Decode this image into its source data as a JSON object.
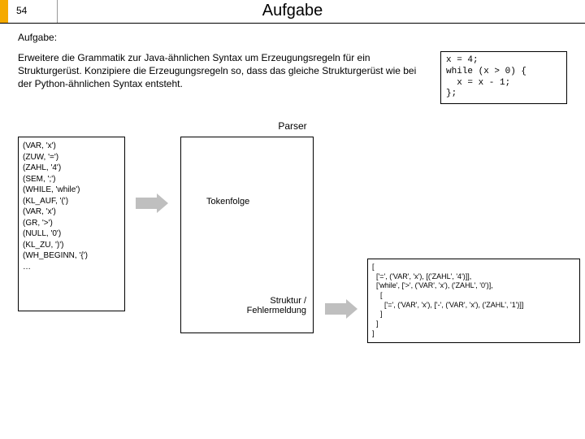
{
  "header": {
    "page_number": "54",
    "title": "Aufgabe"
  },
  "subhead": "Aufgabe:",
  "description": "Erweitere die Grammatik zur Java-ähnlichen Syntax um Erzeugungsregeln für ein Strukturgerüst. Konzipiere die Erzeugungsregeln so, dass das gleiche Strukturgerüst wie bei der Python-ähnlichen Syntax entsteht.",
  "source_code": "x = 4;\nwhile (x > 0) {\n  x = x - 1;\n};",
  "parser": {
    "label": "Parser",
    "input_label": "Tokenfolge",
    "output_label": "Struktur /\nFehlermeldung"
  },
  "tokens": "(VAR, 'x')\n(ZUW, '=')\n(ZAHL, '4')\n(SEM, ';')\n(WHILE, 'while')\n(KL_AUF, '(')\n(VAR, 'x')\n(GR, '>')\n(NULL, '0')\n(KL_ZU, ')')\n(WH_BEGINN, '{')\n…",
  "output_structure": "[\n  ['=', ('VAR', 'x'), [('ZAHL', '4')]],\n  ['while', ['>', ('VAR', 'x'), ('ZAHL', '0')],\n    [\n      ['=', ('VAR', 'x'), ['-', ('VAR', 'x'), ('ZAHL', '1')]]\n    ]\n  ]\n]"
}
